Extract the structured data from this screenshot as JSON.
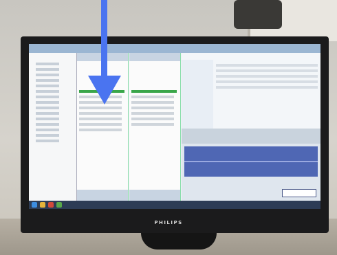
{
  "photo": {
    "brand_logo_text": "PHILIPS",
    "arrow_color": "#4a74f0",
    "highlight_color": "#3aa64a"
  },
  "icons": {
    "monitor": "monitor-icon",
    "arrow": "down-arrow-icon"
  }
}
